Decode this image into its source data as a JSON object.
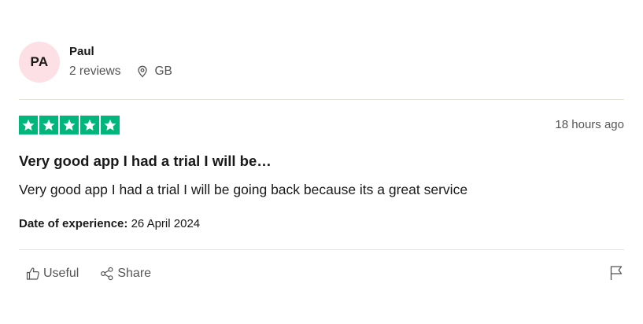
{
  "consumer": {
    "initials": "PA",
    "name": "Paul",
    "reviews_count": "2 reviews",
    "country": "GB",
    "avatar_color": "#fde0e6"
  },
  "review": {
    "rating": 5,
    "star_glyph": "★",
    "star_color": "#00b67a",
    "date": "18 hours ago",
    "title": "Very good app I had a trial I will be…",
    "text": "Very good app I had a trial I will be going back because its a great service",
    "experience_label": "Date of experience:",
    "experience_date": "26 April 2024"
  },
  "actions": {
    "useful_label": "Useful",
    "share_label": "Share",
    "icons": [
      "thumbs-up-icon",
      "share-icon",
      "flag-icon",
      "location-pin-icon"
    ]
  }
}
